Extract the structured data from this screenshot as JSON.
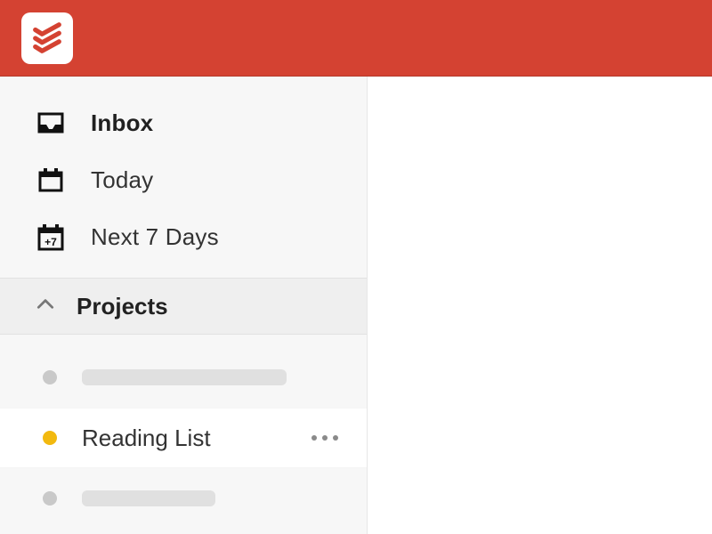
{
  "header": {
    "brand_color": "#d44232"
  },
  "sidebar": {
    "nav": [
      {
        "icon": "inbox-icon",
        "label": "Inbox",
        "bold": true
      },
      {
        "icon": "calendar-icon",
        "label": "Today",
        "bold": false
      },
      {
        "icon": "next7-icon",
        "label": "Next 7 Days",
        "bold": false,
        "badge_text": "+7"
      }
    ],
    "section_label": "Projects",
    "projects": [
      {
        "name": "",
        "dot_color": "grey",
        "selected": false,
        "placeholder": true
      },
      {
        "name": "Reading List",
        "dot_color": "yellow",
        "selected": true,
        "placeholder": false
      },
      {
        "name": "",
        "dot_color": "grey",
        "selected": false,
        "placeholder": true
      }
    ]
  }
}
